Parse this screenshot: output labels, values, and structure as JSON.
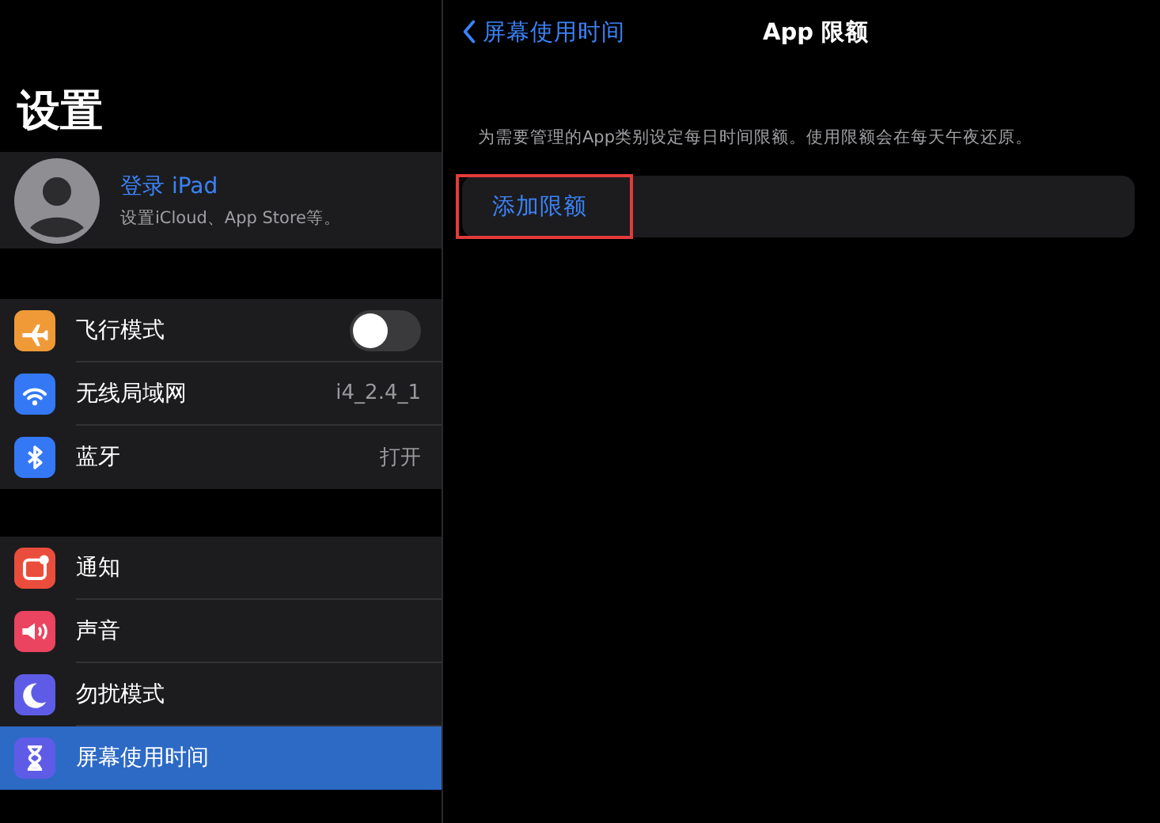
{
  "sidebar": {
    "title": "设置",
    "profile": {
      "name": "登录 iPad",
      "subtitle": "设置iCloud、App Store等。"
    },
    "groups": [
      {
        "items": [
          {
            "label": "飞行模式",
            "kind": "toggle",
            "on": false,
            "selected": false
          },
          {
            "label": "无线局域网",
            "kind": "value",
            "value": "i4_2.4_1",
            "selected": false
          },
          {
            "label": "蓝牙",
            "kind": "value",
            "value": "打开",
            "selected": false
          }
        ]
      },
      {
        "items": [
          {
            "label": "通知",
            "kind": "plain",
            "selected": false
          },
          {
            "label": "声音",
            "kind": "plain",
            "selected": false
          },
          {
            "label": "勿扰模式",
            "kind": "plain",
            "selected": false
          },
          {
            "label": "屏幕使用时间",
            "kind": "plain",
            "selected": true
          }
        ]
      }
    ]
  },
  "detail": {
    "back": "屏幕使用时间",
    "title": "App 限额",
    "description": "为需要管理的App类别设定每日时间限额。使用限额会在每天午夜还原。",
    "action": {
      "label": "添加限额",
      "highlighted": true
    }
  }
}
